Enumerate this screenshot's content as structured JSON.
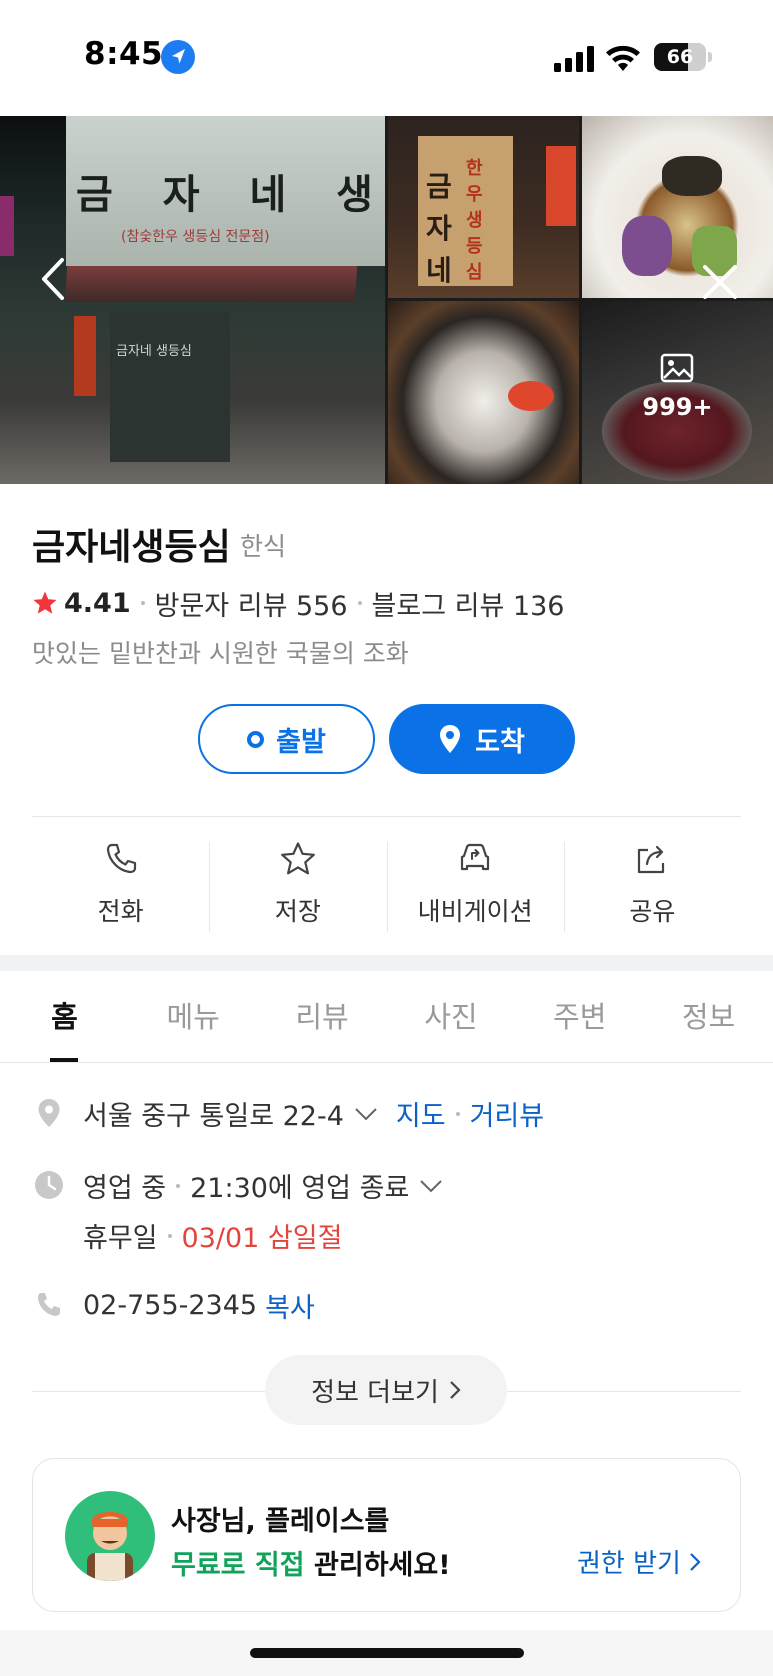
{
  "status_bar": {
    "time": "8:45",
    "battery_percent": 66,
    "battery_label": "66",
    "icons": [
      "location-arrow-icon",
      "cellular-signal-icon",
      "wifi-icon",
      "battery-icon"
    ]
  },
  "gallery": {
    "main_sign_text": "금 자 네  생 등 심",
    "main_sign_subtext": "(참숯한우 생등심 전문점)",
    "main_door_text": "금자네 생등심",
    "photo2_sign_text": "금자네",
    "photo2_side_text": "한우생등심",
    "more_count": "999+",
    "icons": [
      "back-chevron-icon",
      "close-icon",
      "image-icon"
    ]
  },
  "place": {
    "name": "금자네생등심",
    "category": "한식",
    "rating": "4.41",
    "visitor_reviews": "방문자 리뷰 556",
    "blog_reviews": "블로그 리뷰 136",
    "tagline": "맛있는 밑반찬과 시원한 국물의 조화"
  },
  "route": {
    "start_label": "출발",
    "arrive_label": "도착"
  },
  "actions": [
    {
      "label": "전화",
      "icon": "phone-icon"
    },
    {
      "label": "저장",
      "icon": "star-outline-icon"
    },
    {
      "label": "내비게이션",
      "icon": "car-navigation-icon"
    },
    {
      "label": "공유",
      "icon": "share-icon"
    }
  ],
  "tabs": [
    {
      "label": "홈",
      "active": true
    },
    {
      "label": "메뉴",
      "active": false
    },
    {
      "label": "리뷰",
      "active": false
    },
    {
      "label": "사진",
      "active": false
    },
    {
      "label": "주변",
      "active": false
    },
    {
      "label": "정보",
      "active": false
    }
  ],
  "info": {
    "address": "서울 중구 통일로 22-4",
    "map_link": "지도",
    "streetview_link": "거리뷰",
    "status": "영업 중",
    "closing": "21:30에 영업 종료",
    "holiday_label": "휴무일",
    "holiday_value": "03/01 삼일절",
    "phone": "02-755-2345",
    "copy_label": "복사",
    "more_label": "정보 더보기"
  },
  "owner_card": {
    "line1": "사장님, 플레이스를",
    "line2_highlight": "무료로 직접",
    "line2_rest": " 관리하세요!",
    "link_label": "권한 받기"
  },
  "colors": {
    "accent": "#0a72e6",
    "link": "#0a62c9",
    "star": "#f0353d",
    "holiday": "#e2453c",
    "owner_green": "#12a35a"
  }
}
